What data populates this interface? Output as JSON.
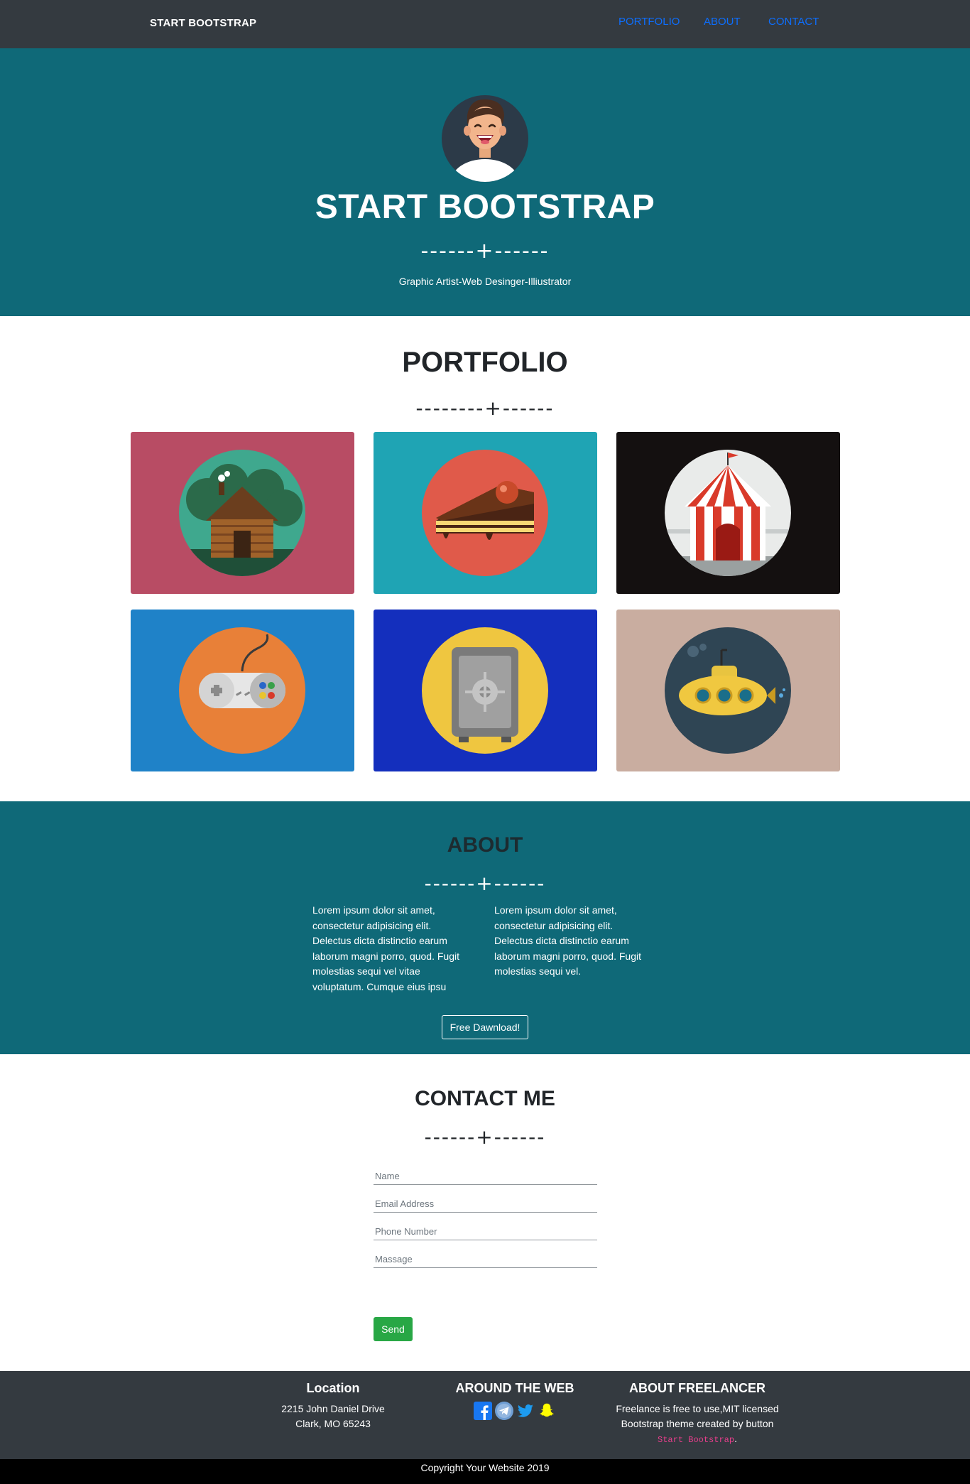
{
  "navbar": {
    "brand": "START BOOTSTRAP",
    "links": [
      "PORTFOLIO",
      "ABOUT",
      "CONTACT"
    ]
  },
  "hero": {
    "title": "START BOOTSTRAP",
    "divider": "------+------",
    "subtitle": "Graphic Artist-Web Desinger-Illiustrator"
  },
  "portfolio": {
    "title": "PORTFOLIO",
    "divider": "--------+------",
    "items": [
      {
        "icon": "cabin-icon",
        "bg": "#b84c64"
      },
      {
        "icon": "cake-icon",
        "bg": "#1fa4b4"
      },
      {
        "icon": "circus-tent-icon",
        "bg": "#141010"
      },
      {
        "icon": "game-controller-icon",
        "bg": "#1f82c8"
      },
      {
        "icon": "safe-icon",
        "bg": "#142fbd"
      },
      {
        "icon": "submarine-icon",
        "bg": "#c9ada0"
      }
    ]
  },
  "about": {
    "title": "ABOUT",
    "divider": "------+------",
    "left_text": "Lorem ipsum dolor sit amet, consectetur adipisicing elit. Delectus dicta distinctio earum laborum magni porro, quod. Fugit molestias sequi vel vitae voluptatum. Cumque eius ipsu",
    "right_text": "Lorem ipsum dolor sit amet, consectetur adipisicing elit. Delectus dicta distinctio earum laborum magni porro, quod. Fugit molestias sequi vel.",
    "button": "Free Dawnload!"
  },
  "contact": {
    "title": "CONTACT ME",
    "divider": "------+------",
    "placeholders": {
      "name": "Name",
      "email": "Email Address",
      "phone": "Phone Number",
      "massage": "Massage"
    },
    "send": "Send"
  },
  "footer": {
    "location": {
      "heading": "Location",
      "line1": "2215 John Daniel Drive",
      "line2": "Clark, MO 65243"
    },
    "web": {
      "heading": "AROUND THE WEB",
      "icons": [
        "facebook-icon",
        "telegram-icon",
        "twitter-icon",
        "snapchat-icon"
      ]
    },
    "about": {
      "heading": "ABOUT FREELANCER",
      "line1": "Freelance is free to use,MIT licensed",
      "line2": "Bootstrap theme created by button",
      "code": "Start Bootstrap",
      "period": "."
    },
    "copyright": "Copyright Your Website 2019"
  },
  "colors": {
    "navbar": "#343a40",
    "teal": "#0f6978",
    "link": "#0d6efd",
    "send": "#28a745",
    "code": "#e83e8c"
  }
}
